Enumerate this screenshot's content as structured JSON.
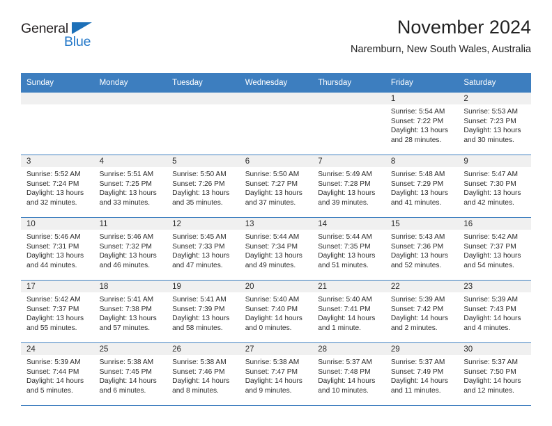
{
  "logo": {
    "text_primary": "General",
    "text_secondary": "Blue",
    "icon": "triangle-icon",
    "primary_color": "#231f20",
    "secondary_color": "#2277c8"
  },
  "header": {
    "title": "November 2024",
    "subtitle": "Naremburn, New South Wales, Australia"
  },
  "theme": {
    "header_blue": "#3d7ebf",
    "daynum_band": "#f0f0f0",
    "text": "#2b2b2b"
  },
  "calendar": {
    "weekday_headers": [
      "Sunday",
      "Monday",
      "Tuesday",
      "Wednesday",
      "Thursday",
      "Friday",
      "Saturday"
    ],
    "weeks": [
      [
        {
          "day": "",
          "sunrise": "",
          "sunset": "",
          "daylight": ""
        },
        {
          "day": "",
          "sunrise": "",
          "sunset": "",
          "daylight": ""
        },
        {
          "day": "",
          "sunrise": "",
          "sunset": "",
          "daylight": ""
        },
        {
          "day": "",
          "sunrise": "",
          "sunset": "",
          "daylight": ""
        },
        {
          "day": "",
          "sunrise": "",
          "sunset": "",
          "daylight": ""
        },
        {
          "day": "1",
          "sunrise": "Sunrise: 5:54 AM",
          "sunset": "Sunset: 7:22 PM",
          "daylight": "Daylight: 13 hours and 28 minutes."
        },
        {
          "day": "2",
          "sunrise": "Sunrise: 5:53 AM",
          "sunset": "Sunset: 7:23 PM",
          "daylight": "Daylight: 13 hours and 30 minutes."
        }
      ],
      [
        {
          "day": "3",
          "sunrise": "Sunrise: 5:52 AM",
          "sunset": "Sunset: 7:24 PM",
          "daylight": "Daylight: 13 hours and 32 minutes."
        },
        {
          "day": "4",
          "sunrise": "Sunrise: 5:51 AM",
          "sunset": "Sunset: 7:25 PM",
          "daylight": "Daylight: 13 hours and 33 minutes."
        },
        {
          "day": "5",
          "sunrise": "Sunrise: 5:50 AM",
          "sunset": "Sunset: 7:26 PM",
          "daylight": "Daylight: 13 hours and 35 minutes."
        },
        {
          "day": "6",
          "sunrise": "Sunrise: 5:50 AM",
          "sunset": "Sunset: 7:27 PM",
          "daylight": "Daylight: 13 hours and 37 minutes."
        },
        {
          "day": "7",
          "sunrise": "Sunrise: 5:49 AM",
          "sunset": "Sunset: 7:28 PM",
          "daylight": "Daylight: 13 hours and 39 minutes."
        },
        {
          "day": "8",
          "sunrise": "Sunrise: 5:48 AM",
          "sunset": "Sunset: 7:29 PM",
          "daylight": "Daylight: 13 hours and 41 minutes."
        },
        {
          "day": "9",
          "sunrise": "Sunrise: 5:47 AM",
          "sunset": "Sunset: 7:30 PM",
          "daylight": "Daylight: 13 hours and 42 minutes."
        }
      ],
      [
        {
          "day": "10",
          "sunrise": "Sunrise: 5:46 AM",
          "sunset": "Sunset: 7:31 PM",
          "daylight": "Daylight: 13 hours and 44 minutes."
        },
        {
          "day": "11",
          "sunrise": "Sunrise: 5:46 AM",
          "sunset": "Sunset: 7:32 PM",
          "daylight": "Daylight: 13 hours and 46 minutes."
        },
        {
          "day": "12",
          "sunrise": "Sunrise: 5:45 AM",
          "sunset": "Sunset: 7:33 PM",
          "daylight": "Daylight: 13 hours and 47 minutes."
        },
        {
          "day": "13",
          "sunrise": "Sunrise: 5:44 AM",
          "sunset": "Sunset: 7:34 PM",
          "daylight": "Daylight: 13 hours and 49 minutes."
        },
        {
          "day": "14",
          "sunrise": "Sunrise: 5:44 AM",
          "sunset": "Sunset: 7:35 PM",
          "daylight": "Daylight: 13 hours and 51 minutes."
        },
        {
          "day": "15",
          "sunrise": "Sunrise: 5:43 AM",
          "sunset": "Sunset: 7:36 PM",
          "daylight": "Daylight: 13 hours and 52 minutes."
        },
        {
          "day": "16",
          "sunrise": "Sunrise: 5:42 AM",
          "sunset": "Sunset: 7:37 PM",
          "daylight": "Daylight: 13 hours and 54 minutes."
        }
      ],
      [
        {
          "day": "17",
          "sunrise": "Sunrise: 5:42 AM",
          "sunset": "Sunset: 7:37 PM",
          "daylight": "Daylight: 13 hours and 55 minutes."
        },
        {
          "day": "18",
          "sunrise": "Sunrise: 5:41 AM",
          "sunset": "Sunset: 7:38 PM",
          "daylight": "Daylight: 13 hours and 57 minutes."
        },
        {
          "day": "19",
          "sunrise": "Sunrise: 5:41 AM",
          "sunset": "Sunset: 7:39 PM",
          "daylight": "Daylight: 13 hours and 58 minutes."
        },
        {
          "day": "20",
          "sunrise": "Sunrise: 5:40 AM",
          "sunset": "Sunset: 7:40 PM",
          "daylight": "Daylight: 14 hours and 0 minutes."
        },
        {
          "day": "21",
          "sunrise": "Sunrise: 5:40 AM",
          "sunset": "Sunset: 7:41 PM",
          "daylight": "Daylight: 14 hours and 1 minute."
        },
        {
          "day": "22",
          "sunrise": "Sunrise: 5:39 AM",
          "sunset": "Sunset: 7:42 PM",
          "daylight": "Daylight: 14 hours and 2 minutes."
        },
        {
          "day": "23",
          "sunrise": "Sunrise: 5:39 AM",
          "sunset": "Sunset: 7:43 PM",
          "daylight": "Daylight: 14 hours and 4 minutes."
        }
      ],
      [
        {
          "day": "24",
          "sunrise": "Sunrise: 5:39 AM",
          "sunset": "Sunset: 7:44 PM",
          "daylight": "Daylight: 14 hours and 5 minutes."
        },
        {
          "day": "25",
          "sunrise": "Sunrise: 5:38 AM",
          "sunset": "Sunset: 7:45 PM",
          "daylight": "Daylight: 14 hours and 6 minutes."
        },
        {
          "day": "26",
          "sunrise": "Sunrise: 5:38 AM",
          "sunset": "Sunset: 7:46 PM",
          "daylight": "Daylight: 14 hours and 8 minutes."
        },
        {
          "day": "27",
          "sunrise": "Sunrise: 5:38 AM",
          "sunset": "Sunset: 7:47 PM",
          "daylight": "Daylight: 14 hours and 9 minutes."
        },
        {
          "day": "28",
          "sunrise": "Sunrise: 5:37 AM",
          "sunset": "Sunset: 7:48 PM",
          "daylight": "Daylight: 14 hours and 10 minutes."
        },
        {
          "day": "29",
          "sunrise": "Sunrise: 5:37 AM",
          "sunset": "Sunset: 7:49 PM",
          "daylight": "Daylight: 14 hours and 11 minutes."
        },
        {
          "day": "30",
          "sunrise": "Sunrise: 5:37 AM",
          "sunset": "Sunset: 7:50 PM",
          "daylight": "Daylight: 14 hours and 12 minutes."
        }
      ]
    ]
  }
}
